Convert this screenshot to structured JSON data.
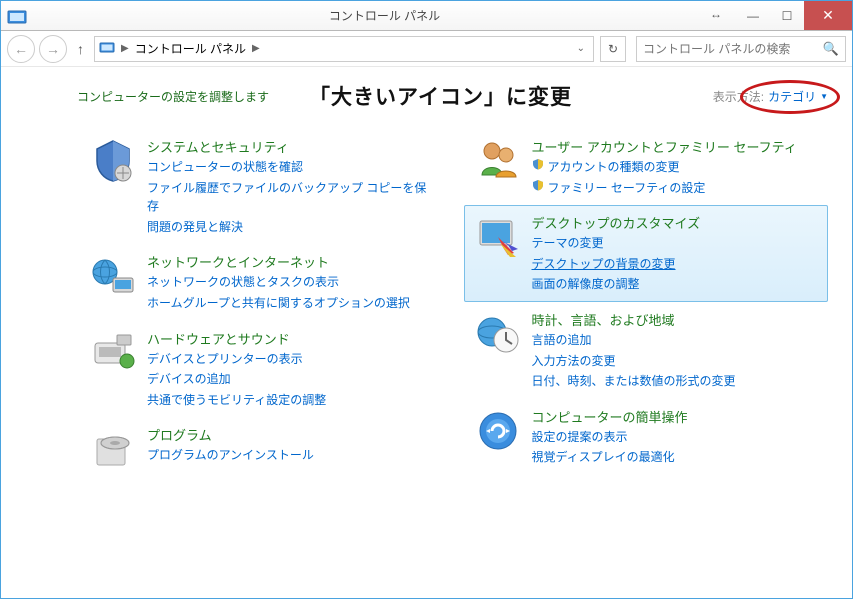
{
  "window": {
    "title": "コントロール パネル"
  },
  "nav": {
    "breadcrumb": "コントロール パネル",
    "search_placeholder": "コントロール パネルの検索"
  },
  "header": {
    "adjust_label": "コンピューターの設定を調整します",
    "annotation": "「大きいアイコン」に変更",
    "viewby_label": "表示方法:",
    "viewby_value": "カテゴリ"
  },
  "left": [
    {
      "title": "システムとセキュリティ",
      "subs": [
        {
          "text": "コンピューターの状態を確認",
          "shield": false
        },
        {
          "text": "ファイル履歴でファイルのバックアップ コピーを保存",
          "shield": false
        },
        {
          "text": "問題の発見と解決",
          "shield": false
        }
      ]
    },
    {
      "title": "ネットワークとインターネット",
      "subs": [
        {
          "text": "ネットワークの状態とタスクの表示",
          "shield": false
        },
        {
          "text": "ホームグループと共有に関するオプションの選択",
          "shield": false
        }
      ]
    },
    {
      "title": "ハードウェアとサウンド",
      "subs": [
        {
          "text": "デバイスとプリンターの表示",
          "shield": false
        },
        {
          "text": "デバイスの追加",
          "shield": false
        },
        {
          "text": "共通で使うモビリティ設定の調整",
          "shield": false
        }
      ]
    },
    {
      "title": "プログラム",
      "subs": [
        {
          "text": "プログラムのアンインストール",
          "shield": false
        }
      ]
    }
  ],
  "right": [
    {
      "title": "ユーザー アカウントとファミリー セーフティ",
      "subs": [
        {
          "text": "アカウントの種類の変更",
          "shield": true
        },
        {
          "text": "ファミリー セーフティの設定",
          "shield": true
        }
      ]
    },
    {
      "title": "デスクトップのカスタマイズ",
      "highlight": true,
      "subs": [
        {
          "text": "テーマの変更",
          "shield": false
        },
        {
          "text": "デスクトップの背景の変更",
          "shield": false,
          "underline": true
        },
        {
          "text": "画面の解像度の調整",
          "shield": false
        }
      ]
    },
    {
      "title": "時計、言語、および地域",
      "subs": [
        {
          "text": "言語の追加",
          "shield": false
        },
        {
          "text": "入力方法の変更",
          "shield": false
        },
        {
          "text": "日付、時刻、または数値の形式の変更",
          "shield": false
        }
      ]
    },
    {
      "title": "コンピューターの簡単操作",
      "subs": [
        {
          "text": "設定の提案の表示",
          "shield": false
        },
        {
          "text": "視覚ディスプレイの最適化",
          "shield": false
        }
      ]
    }
  ],
  "icons": {
    "left": [
      "system",
      "network",
      "hardware",
      "programs"
    ],
    "right": [
      "user",
      "desktop",
      "clock",
      "ease"
    ]
  }
}
